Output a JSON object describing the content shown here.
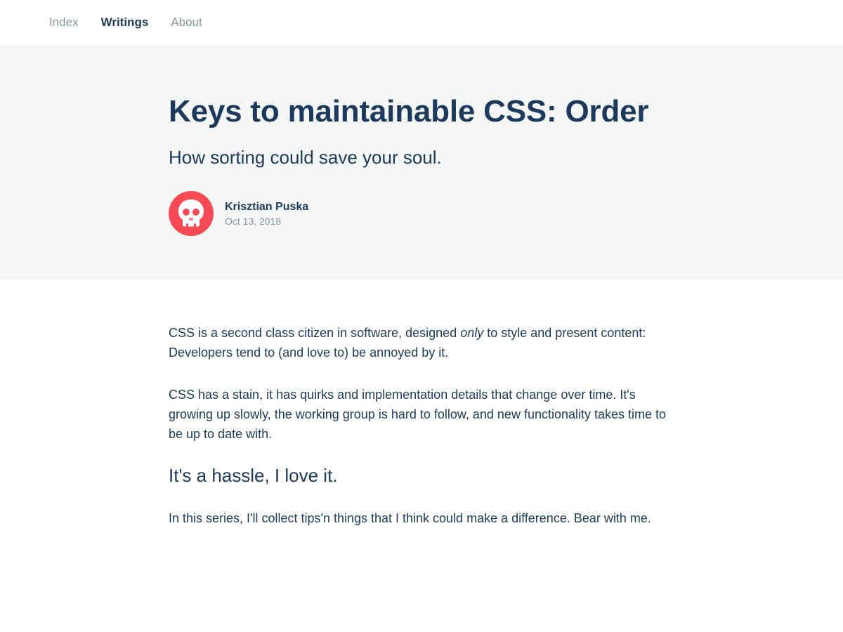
{
  "nav": {
    "items": [
      {
        "label": "Index",
        "active": false
      },
      {
        "label": "Writings",
        "active": true
      },
      {
        "label": "About",
        "active": false
      }
    ]
  },
  "article": {
    "title": "Keys to maintainable CSS: Order",
    "subtitle": "How sorting could save your soul.",
    "author": {
      "name": "Krisztian Puska",
      "date": "Oct 13, 2018",
      "avatar_icon": "skull-icon",
      "avatar_color": "#f74a55"
    },
    "p1_before": "CSS is a second class citizen in software, designed ",
    "p1_em": "only",
    "p1_after": " to style and present content: Developers tend to (and love to) be annoyed by it.",
    "p2": "CSS has a stain, it has quirks and implementation details that change over time. It's growing up slowly, the working group is hard to follow, and new functionality takes time to be up to date with.",
    "heading": "It's a hassle, I love it.",
    "p3": "In this series, I'll collect tips'n things that I think could make a difference. Bear with me."
  },
  "colors": {
    "text": "#1d3a5c",
    "muted": "#8a939c",
    "hero_bg": "#f5f7f7",
    "accent": "#f74a55"
  }
}
